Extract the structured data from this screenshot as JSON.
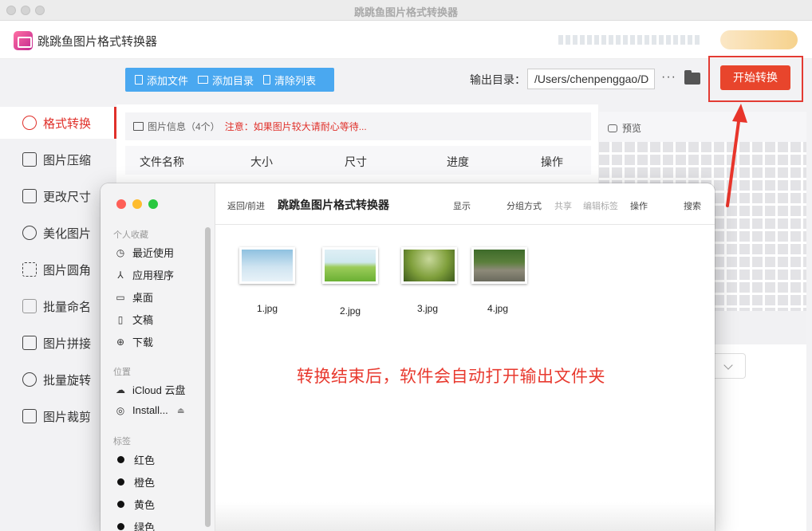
{
  "window": {
    "title": "跳跳鱼图片格式转换器"
  },
  "app": {
    "name": "跳跳鱼图片格式转换器"
  },
  "sidebar": {
    "items": [
      {
        "label": "格式转换",
        "icon": "convert-icon",
        "active": true
      },
      {
        "label": "图片压缩",
        "icon": "compress-icon"
      },
      {
        "label": "更改尺寸",
        "icon": "resize-icon"
      },
      {
        "label": "美化图片",
        "icon": "beautify-icon"
      },
      {
        "label": "图片圆角",
        "icon": "rounded-corner-icon"
      },
      {
        "label": "批量命名",
        "icon": "rename-icon"
      },
      {
        "label": "图片拼接",
        "icon": "stitch-icon"
      },
      {
        "label": "批量旋转",
        "icon": "rotate-icon"
      },
      {
        "label": "图片裁剪",
        "icon": "crop-icon"
      }
    ]
  },
  "toolbar": {
    "add_file": "添加文件",
    "add_dir": "添加目录",
    "clear_list": "清除列表",
    "output_label": "输出目录：",
    "output_path": "/Users/chenpenggao/D",
    "more": "···",
    "start": "开始转换"
  },
  "info": {
    "label": "图片信息（4个）",
    "warning": "注意：如果图片较大请耐心等待..."
  },
  "table": {
    "headers": [
      "文件名称",
      "大小",
      "尺寸",
      "进度",
      "操作"
    ]
  },
  "preview": {
    "label": "预览"
  },
  "finder": {
    "nav": "返回/前进",
    "title": "跳跳鱼图片格式转换器",
    "actions": [
      "显示",
      "分组方式",
      "共享",
      "编辑标签",
      "操作",
      "搜索"
    ],
    "sections": {
      "favorites": "个人收藏",
      "locations": "位置",
      "tags": "标签"
    },
    "favorites": [
      "最近使用",
      "应用程序",
      "桌面",
      "文稿",
      "下载"
    ],
    "locations": [
      "iCloud 云盘",
      "Install..."
    ],
    "tags": [
      "红色",
      "橙色",
      "黄色",
      "绿色"
    ],
    "files": [
      "1.jpg",
      "2.jpg",
      "3.jpg",
      "4.jpg"
    ],
    "note": "转换结束后，软件会自动打开输出文件夹"
  },
  "colors": {
    "accent_red": "#e0302a",
    "toolbar_blue": "#4aa8f0",
    "start_button": "#e8452c"
  }
}
